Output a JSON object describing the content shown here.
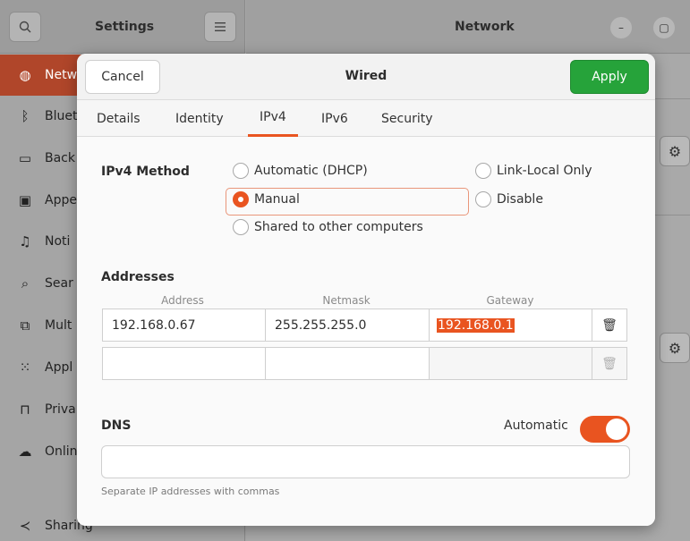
{
  "background": {
    "sidebar_title": "Settings",
    "main_title": "Network",
    "sidebar_items": [
      {
        "label": "Netw",
        "icon": "network-icon"
      },
      {
        "label": "Bluet",
        "icon": "bluetooth-icon"
      },
      {
        "label": "Back",
        "icon": "background-icon"
      },
      {
        "label": "Appe",
        "icon": "appearance-icon"
      },
      {
        "label": "Noti",
        "icon": "bell-icon"
      },
      {
        "label": "Sear",
        "icon": "search-icon"
      },
      {
        "label": "Mult",
        "icon": "multitasking-icon"
      },
      {
        "label": "Appl",
        "icon": "apps-grid-icon"
      },
      {
        "label": "Priva",
        "icon": "lock-icon"
      },
      {
        "label": "Onlin",
        "icon": "cloud-icon"
      },
      {
        "label": "Sharing",
        "icon": "share-icon"
      }
    ]
  },
  "dialog": {
    "title": "Wired",
    "cancel_label": "Cancel",
    "apply_label": "Apply",
    "tabs": [
      "Details",
      "Identity",
      "IPv4",
      "IPv6",
      "Security"
    ],
    "active_tab": "IPv4"
  },
  "ipv4": {
    "method_label": "IPv4 Method",
    "options": {
      "automatic": "Automatic (DHCP)",
      "manual": "Manual",
      "shared": "Shared to other computers",
      "link_local": "Link-Local Only",
      "disable": "Disable"
    },
    "selected": "Manual",
    "addresses_label": "Addresses",
    "columns": [
      "Address",
      "Netmask",
      "Gateway"
    ],
    "rows": [
      {
        "address": "192.168.0.67",
        "netmask": "255.255.255.0",
        "gateway": "192.168.0.1"
      },
      {
        "address": "",
        "netmask": "",
        "gateway": ""
      }
    ],
    "dns_label": "DNS",
    "dns_automatic_label": "Automatic",
    "dns_automatic": true,
    "dns_value": "",
    "dns_hint": "Separate IP addresses with commas"
  },
  "colors": {
    "accent": "#e95420",
    "apply_green": "#26a33a"
  }
}
